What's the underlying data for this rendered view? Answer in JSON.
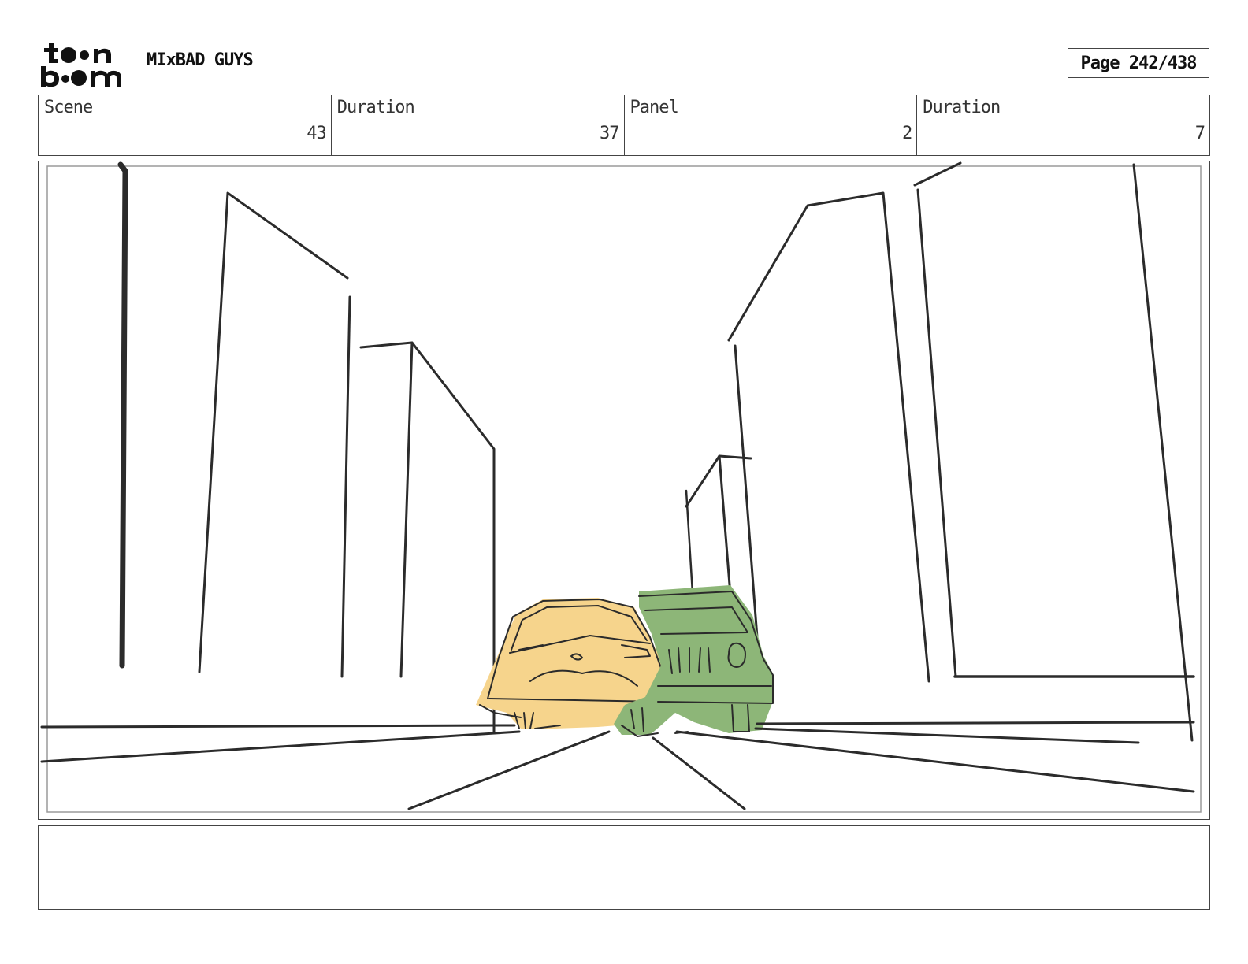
{
  "header": {
    "project_title": "MIxBAD GUYS",
    "page_label": "Page 242/438",
    "logo": {
      "icon": "toon-boom-logo",
      "text": "toon boom"
    }
  },
  "info": {
    "scene_label": "Scene",
    "scene_value": "43",
    "scene_duration_label": "Duration",
    "scene_duration_value": "37",
    "panel_label": "Panel",
    "panel_value": "2",
    "panel_duration_label": "Duration",
    "panel_duration_value": "7"
  },
  "panel": {
    "colors": {
      "yellow_car": "#f6d48c",
      "green_car": "#8db678",
      "line": "#2b2b2b"
    }
  },
  "notes": {
    "text": ""
  }
}
